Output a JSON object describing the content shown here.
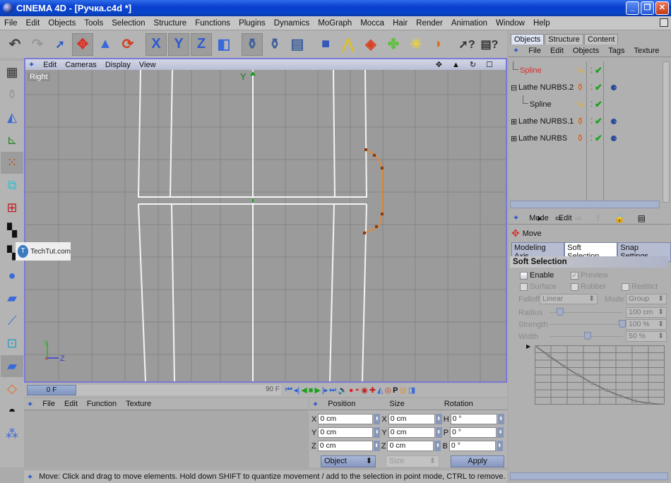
{
  "window": {
    "title": "CINEMA 4D - [Ручка.c4d *]",
    "buttons": [
      "minimize",
      "restore",
      "close"
    ]
  },
  "menubar": [
    "File",
    "Edit",
    "Objects",
    "Tools",
    "Selection",
    "Structure",
    "Functions",
    "Plugins",
    "Dynamics",
    "MoGraph",
    "Mocca",
    "Hair",
    "Render",
    "Animation",
    "Window",
    "Help"
  ],
  "toolbar": {
    "icons": [
      "undo-icon",
      "redo-icon",
      "live-selection-icon",
      "move-icon",
      "scale-icon",
      "rotate-icon",
      "x-axis-lock-icon",
      "y-axis-lock-icon",
      "z-axis-lock-icon",
      "world-coordinates-icon",
      "render-view-icon",
      "render-picture-viewer-icon",
      "render-settings-icon",
      "cube-primitive-icon",
      "spline-pen-icon",
      "nurbs-icon",
      "array-icon",
      "scene-light-icon",
      "deformer-icon",
      "help-cursor-icon",
      "help-window-icon"
    ],
    "axis_labels": {
      "x": "X",
      "y": "Y",
      "z": "Z",
      "x_sub": "H",
      "y_sub": "P",
      "z_sub": "B"
    }
  },
  "left_tools": [
    "layout-icon",
    "vase-icon",
    "object-axis-icon",
    "model-mode-icon",
    "points-mode-icon",
    "edges-mode-icon",
    "polygons-mode-icon",
    "texture-mode-icon",
    "object-texture-icon",
    "primitives-icon",
    "plane-icon",
    "ik-chain-icon",
    "snap-icon",
    "polygon-tool-icon",
    "hypernurbs-tool-icon",
    "hair-tool-icon",
    "particle-tool-icon"
  ],
  "viewport": {
    "menu": [
      "Edit",
      "Cameras",
      "Display",
      "View"
    ],
    "label": "Right",
    "axis_y": "Y",
    "axis_z": "Z",
    "gizmo_y": "Y",
    "watermark": "TechTut.com",
    "watermark_logo": "T"
  },
  "timeline": {
    "current_frame": "0 F",
    "end_frame": "90 F"
  },
  "materials": {
    "menu": [
      "File",
      "Edit",
      "Function",
      "Texture"
    ]
  },
  "coordinates": {
    "headers": [
      "Position",
      "Size",
      "Rotation"
    ],
    "position": {
      "x": "0 cm",
      "y": "0 cm",
      "z": "0 cm"
    },
    "size": {
      "x": "0 cm",
      "y": "0 cm",
      "z": "0 cm"
    },
    "rotation": {
      "h": "0 °",
      "p": "0 °",
      "b": "0 °"
    },
    "axis_labels": {
      "x": "X",
      "y": "Y",
      "z": "Z",
      "h": "H",
      "p": "P",
      "b": "B"
    },
    "mode_select": "Object",
    "size_select": "Size",
    "apply": "Apply"
  },
  "status": "Move: Click and drag to move elements. Hold down SHIFT to quantize movement / add to the selection in point mode, CTRL to remove.",
  "objects_panel": {
    "tabs": [
      "Objects",
      "Structure",
      "Content"
    ],
    "menu": [
      "File",
      "Edit",
      "Objects",
      "Tags",
      "Texture"
    ],
    "items": [
      {
        "name": "Spline",
        "selected": true,
        "indent": 0,
        "expander": "",
        "icon": "spline-icon",
        "tag": ""
      },
      {
        "name": "Lathe NURBS.2",
        "selected": false,
        "indent": 0,
        "expander": "⊟",
        "icon": "lathe-nurbs-icon",
        "tag": "phong-tag-icon"
      },
      {
        "name": "Spline",
        "selected": false,
        "indent": 1,
        "expander": "",
        "icon": "spline-icon",
        "tag": ""
      },
      {
        "name": "Lathe NURBS.1",
        "selected": false,
        "indent": 0,
        "expander": "⊞",
        "icon": "lathe-nurbs-icon",
        "tag": "phong-tag-icon"
      },
      {
        "name": "Lathe NURBS",
        "selected": false,
        "indent": 0,
        "expander": "⊞",
        "icon": "lathe-nurbs-icon",
        "tag": "phong-tag-icon"
      }
    ]
  },
  "attributes_panel": {
    "menu": [
      "Mode",
      "Edit"
    ],
    "tool": "Move",
    "tabs": [
      "Modeling Axis",
      "Soft Selection",
      "Snap Settings"
    ],
    "active_tab": "Soft Selection",
    "section": "Soft Selection",
    "enable": {
      "label": "Enable",
      "checked": false
    },
    "preview": {
      "label": "Preview",
      "checked": true
    },
    "surface": {
      "label": "Surface",
      "checked": false
    },
    "rubber": {
      "label": "Rubber",
      "checked": false
    },
    "restrict": {
      "label": "Restrict",
      "checked": false
    },
    "falloff_label": "Falloff",
    "falloff": "Linear",
    "mode_label": "Mode",
    "mode": "Group",
    "radius_label": "Radius",
    "radius": "100 cm",
    "radius_slider": 0.1,
    "strength_label": "Strength",
    "strength": "100 %",
    "strength_slider": 1.0,
    "width_label": "Width",
    "width": "50 %",
    "width_slider": 0.5,
    "falloff_curve": [
      1.0,
      0.82,
      0.65,
      0.5,
      0.36,
      0.24,
      0.14,
      0.06,
      0.02,
      0.0
    ]
  },
  "colors": {
    "accent": "#0a3fcf",
    "viewport_border": "#7a7ad8",
    "selected_object": "#e0282a",
    "check": "#18a018",
    "spline": "#e08a3a"
  }
}
